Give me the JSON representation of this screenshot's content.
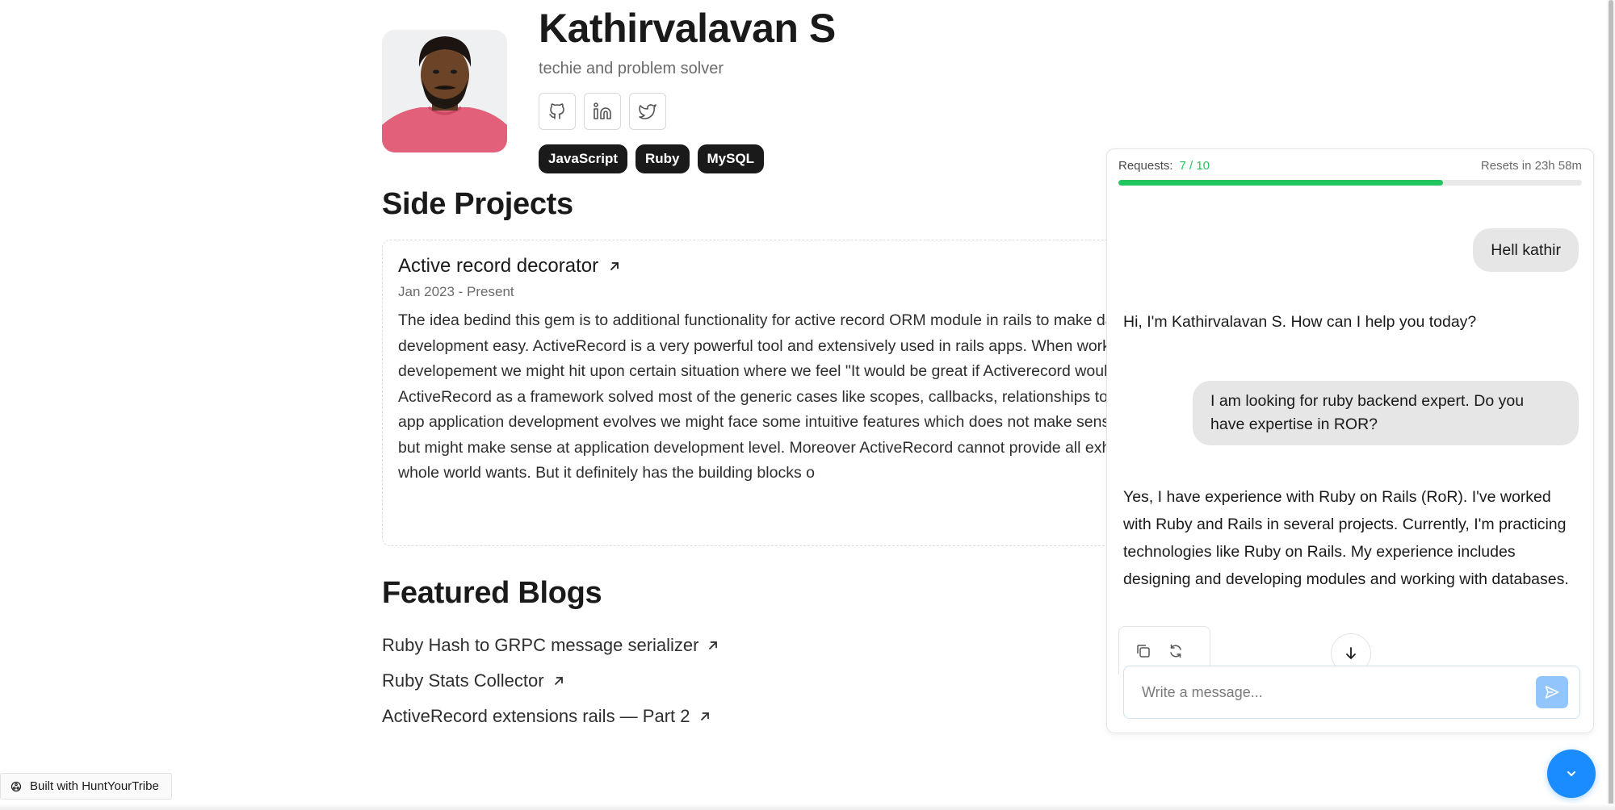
{
  "profile": {
    "name": "Kathirvalavan S",
    "tagline": "techie and problem solver",
    "socials": [
      {
        "icon": "github-icon"
      },
      {
        "icon": "linkedin-icon"
      },
      {
        "icon": "twitter-icon"
      }
    ],
    "skills": [
      "JavaScript",
      "Ruby",
      "MySQL"
    ]
  },
  "side_projects": {
    "title": "Side Projects",
    "projects": [
      {
        "title": "Active record decorator",
        "dates": "Jan 2023 - Present",
        "description": "The idea bedind this gem is to additional functionality for active record ORM module in rails to make day to day application development easy. ActiveRecord is a very powerful tool and extensively used in rails apps. When working on application developement we might hit upon certain situation where we feel \"It would be great if Activerecord would have given us this\". ActiveRecord as a framework solved most of the generic cases like scopes, callbacks, relationships to larger extent. But as app application development evolves we might face some intuitive features which does not make sense at framework level but might make sense at application development level. Moreover ActiveRecord cannot provide all exhaustive features the whole world wants. But it definitely has the building blocks o"
      }
    ]
  },
  "featured_blogs": {
    "title": "Featured Blogs",
    "items": [
      "Ruby Hash to GRPC message serializer",
      "Ruby Stats Collector",
      "ActiveRecord extensions rails — Part 2"
    ]
  },
  "footer": {
    "built_with": "Built with HuntYourTribe"
  },
  "chat": {
    "quota": {
      "label": "Requests:",
      "count": "7 / 10",
      "used_fraction": 0.7,
      "reset": "Resets in 23h 58m"
    },
    "messages": [
      {
        "role": "user",
        "text": "Hell kathir"
      },
      {
        "role": "assistant",
        "text": "Hi, I'm Kathirvalavan S. How can I help you today?"
      },
      {
        "role": "user",
        "text": "I am looking for ruby backend expert. Do you have expertise in ROR?"
      },
      {
        "role": "assistant",
        "text": "Yes, I have experience with Ruby on Rails (RoR). I've worked with Ruby and Rails in several projects. Currently, I'm practicing technologies like Ruby on Rails. My experience includes designing and developing modules and working with databases."
      }
    ],
    "composer_placeholder": "Write a message..."
  },
  "colors": {
    "accent_green": "#22c55e",
    "accent_blue": "#1a8cff",
    "send_button": "#93c5fd",
    "skill_badge": "#1a1a1a"
  }
}
